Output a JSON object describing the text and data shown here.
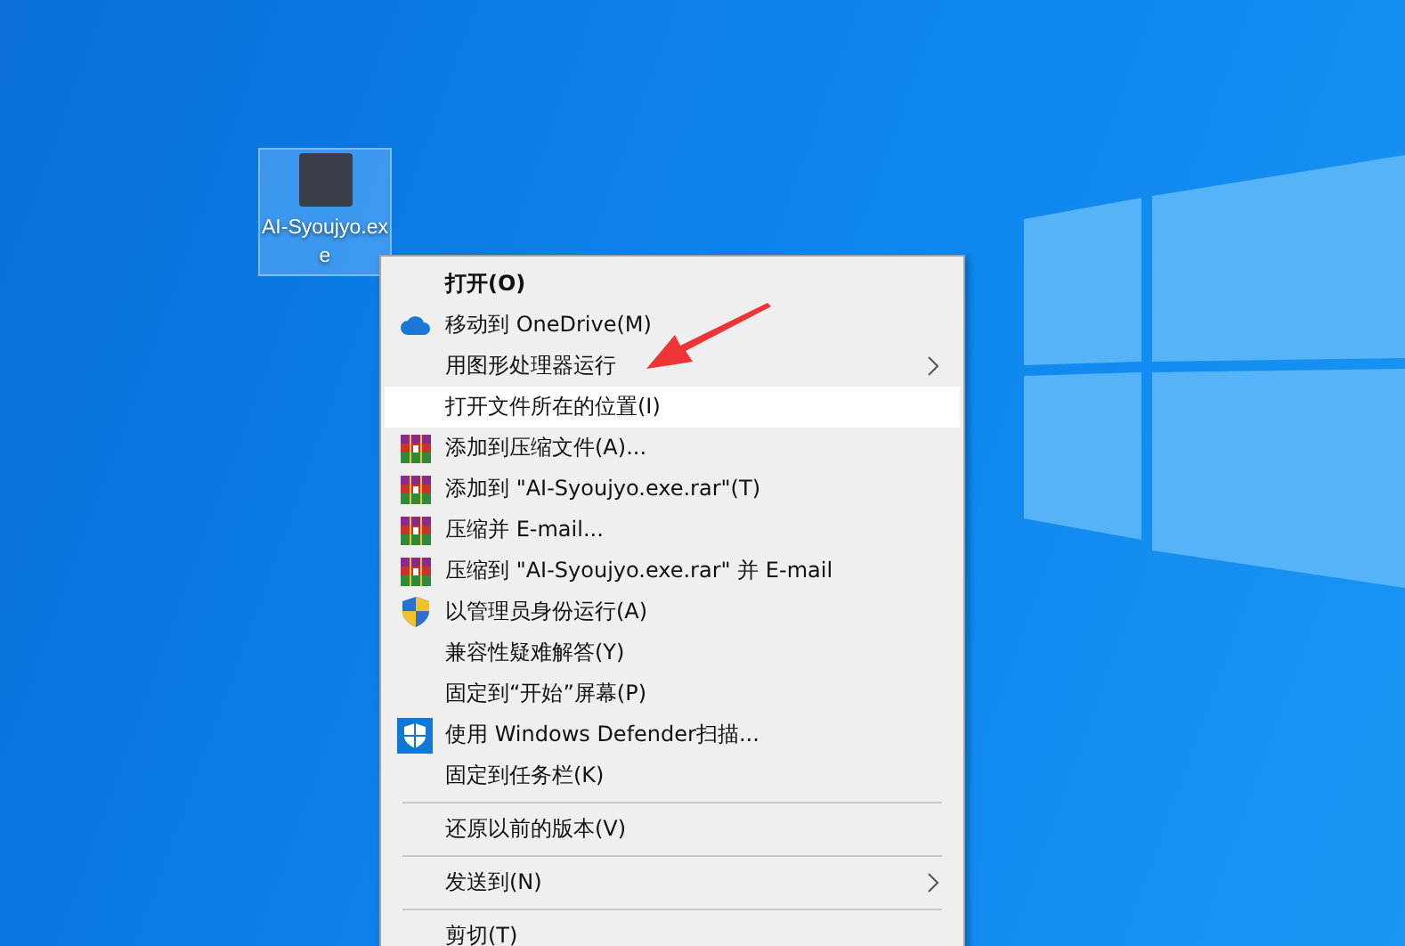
{
  "desktop_icon": {
    "label": "AI-Syoujyo.exe",
    "selected": true
  },
  "context_menu": {
    "items": [
      {
        "kind": "plain",
        "label": "打开(O)",
        "bold": true,
        "submenu": false,
        "selected": false
      },
      {
        "kind": "cloud",
        "label": "移动到 OneDrive(M)",
        "bold": false,
        "submenu": false,
        "selected": false
      },
      {
        "kind": "plain",
        "label": "用图形处理器运行",
        "bold": false,
        "submenu": true,
        "selected": false
      },
      {
        "kind": "plain",
        "label": "打开文件所在的位置(I)",
        "bold": false,
        "submenu": false,
        "selected": true
      },
      {
        "kind": "archive",
        "label": "添加到压缩文件(A)...",
        "bold": false,
        "submenu": false,
        "selected": false
      },
      {
        "kind": "archive",
        "label": "添加到 \"AI-Syoujyo.exe.rar\"(T)",
        "bold": false,
        "submenu": false,
        "selected": false
      },
      {
        "kind": "archive",
        "label": "压缩并 E-mail...",
        "bold": false,
        "submenu": false,
        "selected": false
      },
      {
        "kind": "archive",
        "label": "压缩到 \"AI-Syoujyo.exe.rar\" 并 E-mail",
        "bold": false,
        "submenu": false,
        "selected": false
      },
      {
        "kind": "uac",
        "label": "以管理员身份运行(A)",
        "bold": false,
        "submenu": false,
        "selected": false
      },
      {
        "kind": "plain",
        "label": "兼容性疑难解答(Y)",
        "bold": false,
        "submenu": false,
        "selected": false
      },
      {
        "kind": "plain",
        "label": "固定到“开始”屏幕(P)",
        "bold": false,
        "submenu": false,
        "selected": false
      },
      {
        "kind": "defender",
        "label": "使用 Windows Defender扫描...",
        "bold": false,
        "submenu": false,
        "selected": false
      },
      {
        "kind": "plain",
        "label": "固定到任务栏(K)",
        "bold": false,
        "submenu": false,
        "selected": false
      },
      {
        "kind": "separator"
      },
      {
        "kind": "plain",
        "label": "还原以前的版本(V)",
        "bold": false,
        "submenu": false,
        "selected": false
      },
      {
        "kind": "separator"
      },
      {
        "kind": "plain",
        "label": "发送到(N)",
        "bold": false,
        "submenu": true,
        "selected": false
      },
      {
        "kind": "separator"
      },
      {
        "kind": "plain",
        "label": "剪切(T)",
        "bold": false,
        "submenu": false,
        "selected": false
      }
    ]
  }
}
